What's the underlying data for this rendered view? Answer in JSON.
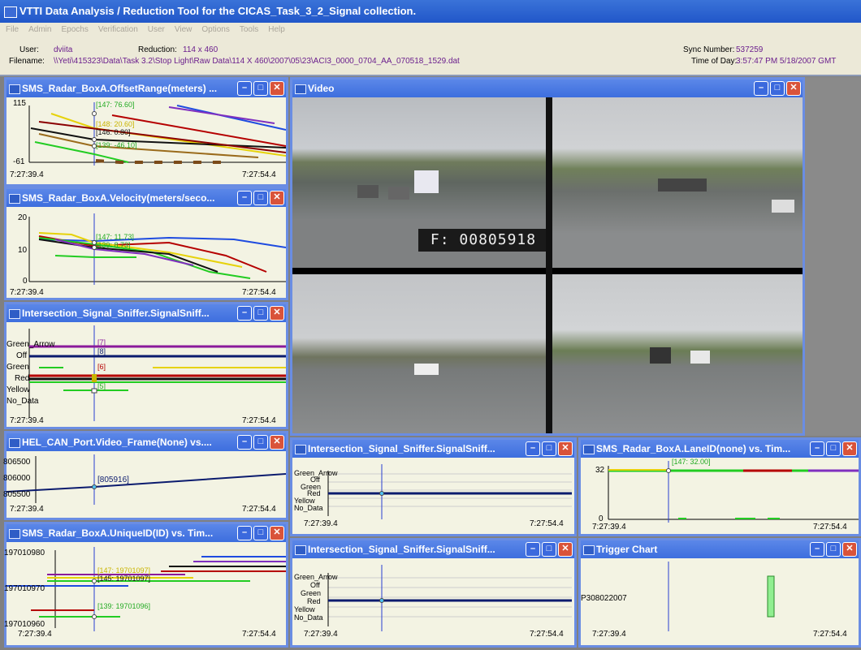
{
  "app": {
    "title": "VTTI Data Analysis / Reduction Tool for the CICAS_Task_3_2_Signal collection.",
    "menu": [
      "File",
      "Admin",
      "Epochs",
      "Verification",
      "User",
      "View",
      "Options",
      "Tools",
      "Help"
    ]
  },
  "info": {
    "user_label": "User:",
    "user": "dviita",
    "reduction_label": "Reduction:",
    "reduction": "114 x 460",
    "filename_label": "Filename:",
    "filename": "\\\\Yeti\\415323\\Data\\Task 3.2\\Stop Light\\Raw Data\\114 X 460\\2007\\05\\23\\ACI3_0000_0704_AA_070518_1529.dat",
    "sync_label": "Sync Number:",
    "sync": "537259",
    "tod_label": "Time of Day:",
    "tod": "3:57:47 PM  5/18/2007 GMT"
  },
  "time": {
    "start": "7:27:39.4",
    "end": "7:27:54.4"
  },
  "panes": {
    "offset": {
      "title": "SMS_Radar_BoxA.OffsetRange(meters) ...",
      "ymax": "115",
      "ymin": "-61",
      "labels": [
        "[147: 76.60]",
        "[148: 20.60]",
        "[146: 0.80]",
        "[139: -46.10]"
      ]
    },
    "velocity": {
      "title": "SMS_Radar_BoxA.Velocity(meters/seco...",
      "y20": "20",
      "y10": "10",
      "y0": "0",
      "labels": [
        "[147: 11.73]",
        "[139: 8.73]"
      ]
    },
    "signal1": {
      "title": "Intersection_Signal_Sniffer.SignalSniff...",
      "states": [
        "Green_Arrow",
        "Off",
        "Green",
        "Red",
        "Yellow",
        "No_Data"
      ],
      "labels": [
        "[7]",
        "[8]",
        "[6]",
        "[5]"
      ]
    },
    "canframe": {
      "title": "HEL_CAN_Port.Video_Frame(None) vs....",
      "y1": "806500",
      "y2": "806000",
      "y3": "805500",
      "label": "[805916]"
    },
    "uniqueid": {
      "title": "SMS_Radar_BoxA.UniqueID(ID) vs. Tim...",
      "y1": "197010980",
      "y2": "197010970",
      "y3": "197010960",
      "labels": [
        "[147: 19701097]",
        "[145: 19701097]",
        "[139: 19701096]"
      ]
    },
    "signal2": {
      "title": "Intersection_Signal_Sniffer.SignalSniff...",
      "states": [
        "Green_Arrow",
        "Off",
        "Green",
        "Red",
        "Yellow",
        "No_Data"
      ]
    },
    "signal3": {
      "title": "Intersection_Signal_Sniffer.SignalSniff...",
      "states": [
        "Green_Arrow",
        "Off",
        "Green",
        "Red",
        "Yellow",
        "No_Data"
      ]
    },
    "laneid": {
      "title": "SMS_Radar_BoxA.LaneID(none) vs. Tim...",
      "y32": "32",
      "y0": "0",
      "label": "[147: 32.00]"
    },
    "trigger": {
      "title": "Trigger Chart",
      "row": "P308022007"
    },
    "video": {
      "title": "Video",
      "frame": "F: 00805918"
    }
  },
  "colors": {
    "titlebar": "#3d6ede",
    "close": "#d9533a",
    "cursor": "#2a3fd0"
  }
}
